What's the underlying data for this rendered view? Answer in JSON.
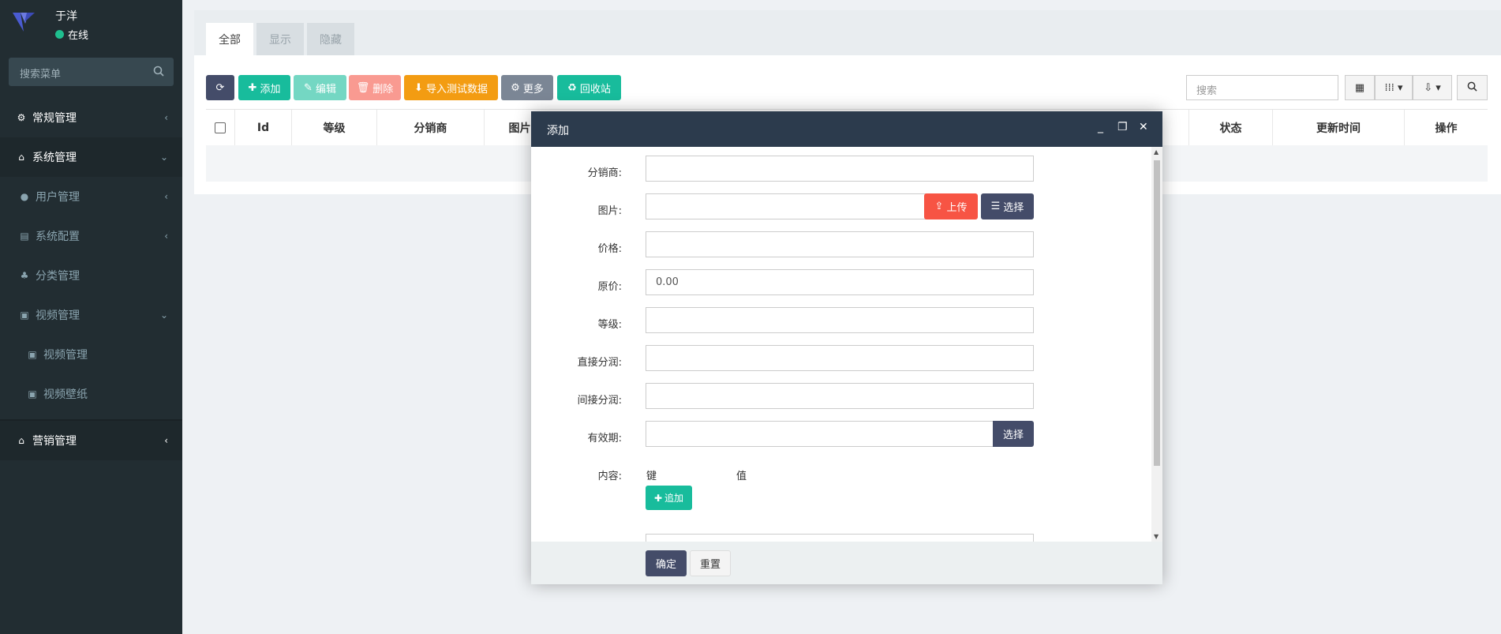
{
  "sidebar": {
    "user_name": "于洋",
    "status": "在线",
    "search_placeholder": "搜索菜单",
    "items": [
      {
        "label": "常规管理"
      },
      {
        "label": "系统管理"
      },
      {
        "label": "用户管理"
      },
      {
        "label": "系统配置"
      },
      {
        "label": "分类管理"
      },
      {
        "label": "视频管理"
      },
      {
        "label": "视频管理"
      },
      {
        "label": "视频壁纸"
      },
      {
        "label": "营销管理"
      }
    ]
  },
  "tabs": [
    "全部",
    "显示",
    "隐藏"
  ],
  "toolbar": {
    "add": "添加",
    "edit": "编辑",
    "delete": "删除",
    "import": "导入测试数据",
    "more": "更多",
    "recycle": "回收站",
    "search_placeholder": "搜索"
  },
  "table": {
    "columns": [
      "Id",
      "等级",
      "分销商",
      "图片",
      "状态",
      "更新时间",
      "操作"
    ]
  },
  "dialog": {
    "title": "添加",
    "fields": {
      "distributor": "分销商:",
      "image": "图片:",
      "price": "价格:",
      "original_price": "原价:",
      "original_price_value": "0.00",
      "level": "等级:",
      "direct_share": "直接分润:",
      "indirect_share": "间接分润:",
      "validity": "有效期:",
      "content": "内容:",
      "key": "键",
      "value": "值"
    },
    "upload": "上传",
    "choose": "选择",
    "validity_choose": "选择",
    "append": "追加",
    "confirm": "确定",
    "reset": "重置"
  },
  "colors": {
    "sidebar_bg": "#222d32",
    "header_dark": "#2c3b4d",
    "green": "#18bc9c",
    "red": "#f75444",
    "orange": "#f39c12"
  }
}
